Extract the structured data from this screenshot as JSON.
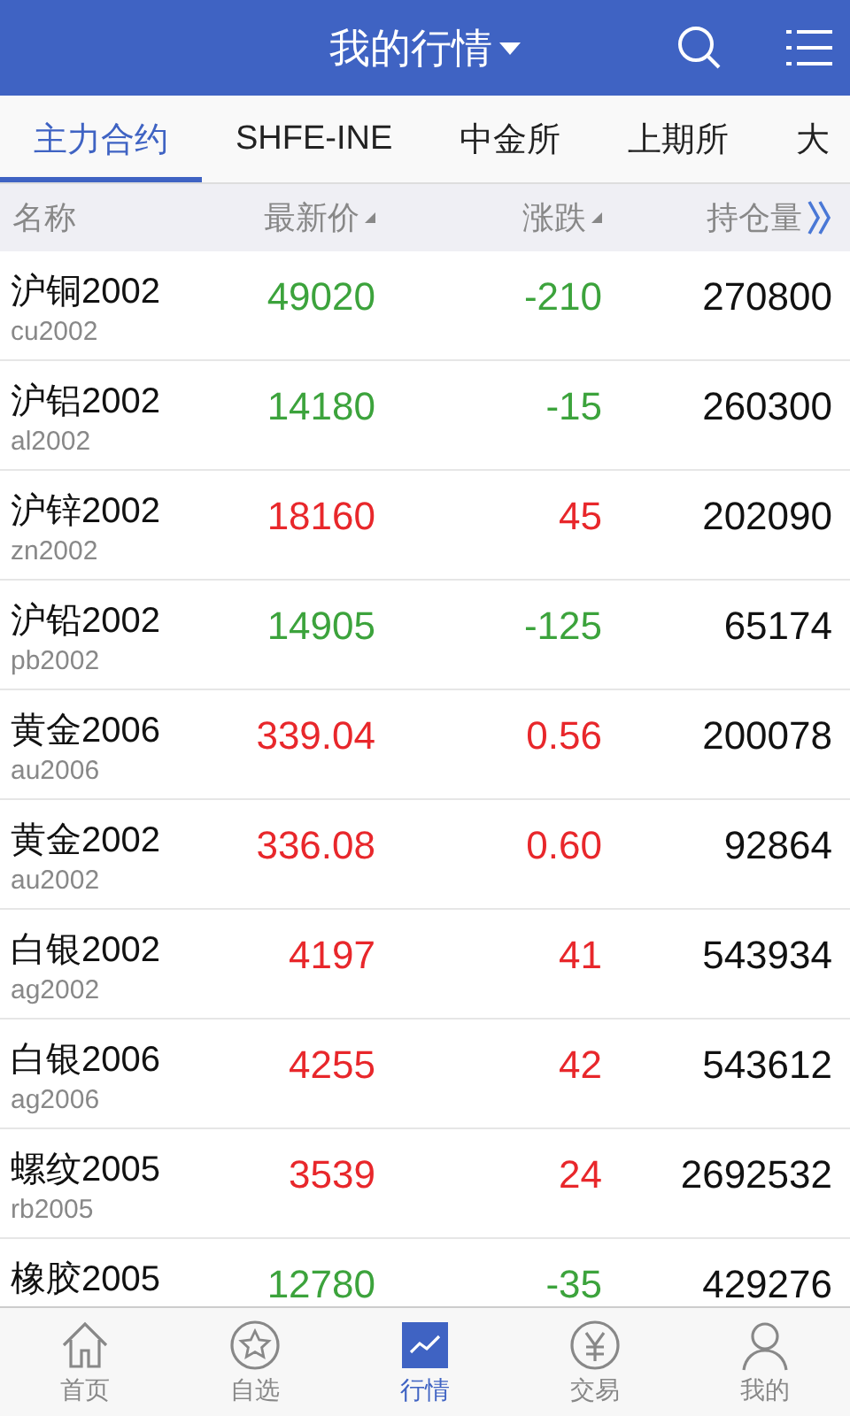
{
  "header": {
    "title": "我的行情"
  },
  "tabs": [
    {
      "label": "主力合约",
      "selected": true
    },
    {
      "label": "SHFE-INE",
      "selected": false
    },
    {
      "label": "中金所",
      "selected": false
    },
    {
      "label": "上期所",
      "selected": false
    },
    {
      "label": "大",
      "selected": false
    }
  ],
  "table": {
    "columns": [
      {
        "label": "名称",
        "sortable": false
      },
      {
        "label": "最新价",
        "sortable": true
      },
      {
        "label": "涨跌",
        "sortable": true
      },
      {
        "label": "持仓量",
        "sortable": false
      }
    ],
    "rows": [
      {
        "name": "沪铜2002",
        "code": "cu2002",
        "price": "49020",
        "change": "-210",
        "open_interest": "270800",
        "color": "#3ca33c"
      },
      {
        "name": "沪铝2002",
        "code": "al2002",
        "price": "14180",
        "change": "-15",
        "open_interest": "260300",
        "color": "#3ca33c"
      },
      {
        "name": "沪锌2002",
        "code": "zn2002",
        "price": "18160",
        "change": "45",
        "open_interest": "202090",
        "color": "#e8272b"
      },
      {
        "name": "沪铅2002",
        "code": "pb2002",
        "price": "14905",
        "change": "-125",
        "open_interest": "65174",
        "color": "#3ca33c"
      },
      {
        "name": "黄金2006",
        "code": "au2006",
        "price": "339.04",
        "change": "0.56",
        "open_interest": "200078",
        "color": "#e8272b"
      },
      {
        "name": "黄金2002",
        "code": "au2002",
        "price": "336.08",
        "change": "0.60",
        "open_interest": "92864",
        "color": "#e8272b"
      },
      {
        "name": "白银2002",
        "code": "ag2002",
        "price": "4197",
        "change": "41",
        "open_interest": "543934",
        "color": "#e8272b"
      },
      {
        "name": "白银2006",
        "code": "ag2006",
        "price": "4255",
        "change": "42",
        "open_interest": "543612",
        "color": "#e8272b"
      },
      {
        "name": "螺纹2005",
        "code": "rb2005",
        "price": "3539",
        "change": "24",
        "open_interest": "2692532",
        "color": "#e8272b"
      },
      {
        "name": "橡胶2005",
        "price": "12780",
        "change": "-35",
        "open_interest": "429276",
        "color": "#3ca33c"
      }
    ]
  },
  "nav": [
    {
      "label": "首页",
      "kind": "home",
      "selected": false
    },
    {
      "label": "自选",
      "kind": "star",
      "selected": false
    },
    {
      "label": "行情",
      "kind": "chart",
      "selected": true
    },
    {
      "label": "交易",
      "kind": "yen",
      "selected": false
    },
    {
      "label": "我的",
      "kind": "person",
      "selected": false
    }
  ]
}
